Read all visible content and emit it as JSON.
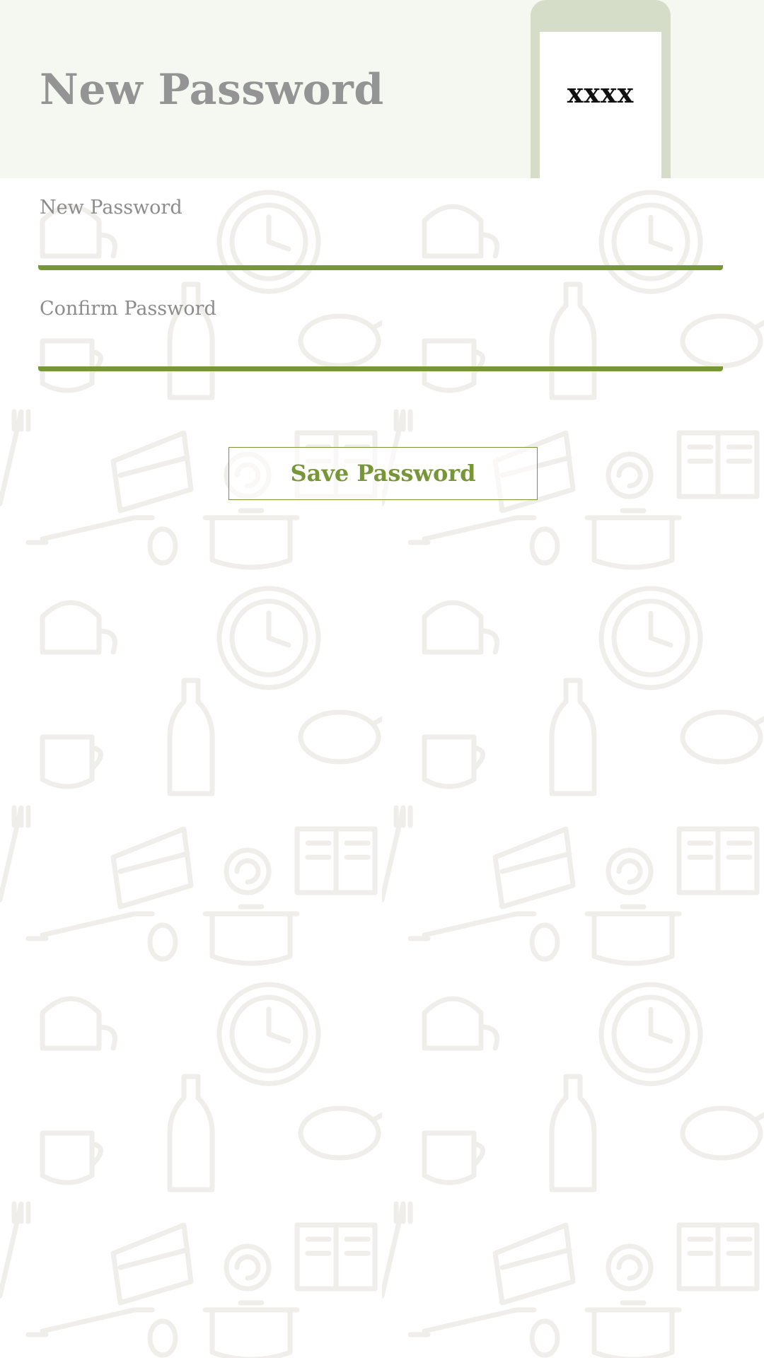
{
  "header": {
    "title": "New Password",
    "phone_code": "xxxx",
    "background_color": "#f5f7f1",
    "phone_color": "#d5dcc7"
  },
  "form": {
    "new_password": {
      "label": "New Password",
      "value": ""
    },
    "confirm_password": {
      "label": "Confirm Password",
      "value": ""
    },
    "save_label": "Save Password"
  },
  "colors": {
    "accent": "#779638",
    "title_text": "#949494",
    "label_text": "#8c8c8c",
    "doodle": "#efeeea"
  },
  "icons": [
    "phone-icon",
    "food-doodle-pattern"
  ]
}
